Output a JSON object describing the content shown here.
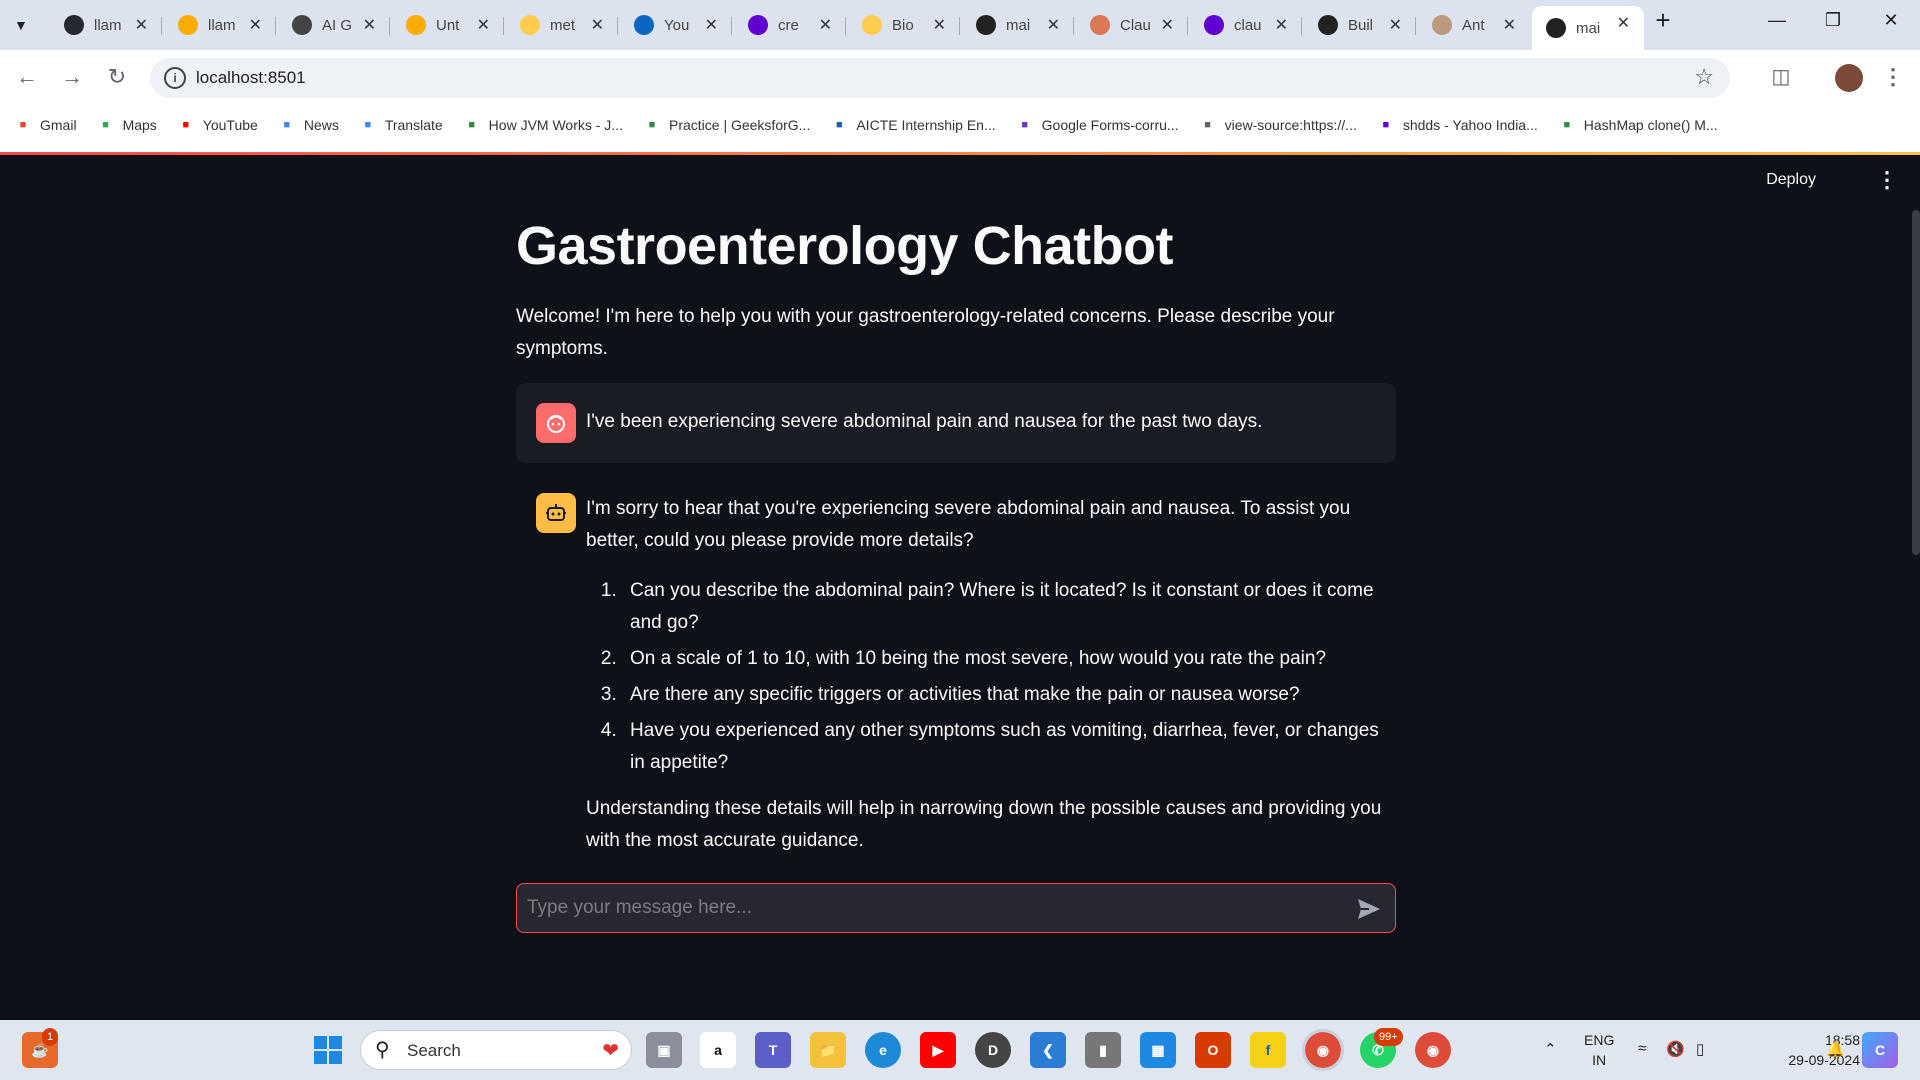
{
  "browser": {
    "tabs": [
      {
        "label": "llam",
        "icon": "github-icon",
        "color": "#24292f"
      },
      {
        "label": "llam",
        "icon": "colab-icon",
        "color": "#f9ab00"
      },
      {
        "label": "AI G",
        "icon": "openai-icon",
        "color": "#444444"
      },
      {
        "label": "Unt",
        "icon": "colab-icon",
        "color": "#f9ab00"
      },
      {
        "label": "met",
        "icon": "huggingface-icon",
        "color": "#ffcc4d"
      },
      {
        "label": "You",
        "icon": "linkedin-icon",
        "color": "#0a66c2"
      },
      {
        "label": "cre",
        "icon": "yahoo-icon",
        "color": "#6001d2"
      },
      {
        "label": "Bio",
        "icon": "huggingface-icon",
        "color": "#ffcc4d"
      },
      {
        "label": "mai",
        "icon": "streamlit-icon",
        "color": "#222222"
      },
      {
        "label": "Clau",
        "icon": "claude-icon",
        "color": "#d97757"
      },
      {
        "label": "clau",
        "icon": "yahoo-icon",
        "color": "#6001d2"
      },
      {
        "label": "Buil",
        "icon": "anthropic-icon",
        "color": "#222222"
      },
      {
        "label": "Ant",
        "icon": "anthropic-icon",
        "color": "#b99a7a"
      },
      {
        "label": "mai",
        "icon": "streamlit-icon",
        "color": "#222222"
      }
    ],
    "url": "localhost:8501",
    "bookmarks": [
      {
        "label": "Gmail",
        "icon": "gmail-icon",
        "color": "#ea4335"
      },
      {
        "label": "Maps",
        "icon": "maps-icon",
        "color": "#34a853"
      },
      {
        "label": "YouTube",
        "icon": "youtube-icon",
        "color": "#ff0000"
      },
      {
        "label": "News",
        "icon": "news-icon",
        "color": "#4285f4"
      },
      {
        "label": "Translate",
        "icon": "translate-icon",
        "color": "#4285f4"
      },
      {
        "label": "How JVM Works - J...",
        "icon": "geeksforgeeks-icon",
        "color": "#2f8d46"
      },
      {
        "label": "Practice | GeeksforG...",
        "icon": "geeksforgeeks-icon",
        "color": "#2f8d46"
      },
      {
        "label": "AICTE Internship En...",
        "icon": "aicte-icon",
        "color": "#1a5fb4"
      },
      {
        "label": "Google Forms-corru...",
        "icon": "forms-icon",
        "color": "#673ab7"
      },
      {
        "label": "view-source:https://...",
        "icon": "globe-icon",
        "color": "#5f6368"
      },
      {
        "label": "shdds - Yahoo India...",
        "icon": "yahoo-icon",
        "color": "#6001d2"
      },
      {
        "label": "HashMap clone() M...",
        "icon": "geeksforgeeks-icon",
        "color": "#2f8d46"
      }
    ]
  },
  "app": {
    "deploy_label": "Deploy",
    "title": "Gastroenterology Chatbot",
    "welcome": "Welcome! I'm here to help you with your gastroenterology-related concerns. Please describe your symptoms.",
    "user_message": "I've been experiencing severe abdominal pain and nausea for the past two days.",
    "assistant": {
      "intro": "I'm sorry to hear that you're experiencing severe abdominal pain and nausea. To assist you better, could you please provide more details?",
      "questions": [
        "Can you describe the abdominal pain? Where is it located? Is it constant or does it come and go?",
        "On a scale of 1 to 10, with 10 being the most severe, how would you rate the pain?",
        "Are there any specific triggers or activities that make the pain or nausea worse?",
        "Have you experienced any other symptoms such as vomiting, diarrhea, fever, or changes in appetite?"
      ],
      "closing": "Understanding these details will help in narrowing down the possible causes and providing you with the most accurate guidance."
    },
    "input_placeholder": "Type your message here...",
    "accent": "#ff4b4b"
  },
  "taskbar": {
    "search_label": "Search",
    "lang_top": "ENG",
    "lang_bottom": "IN",
    "time": "18:58",
    "date": "29-09-2024",
    "java_badge": "1",
    "whatsapp_badge": "99+"
  }
}
